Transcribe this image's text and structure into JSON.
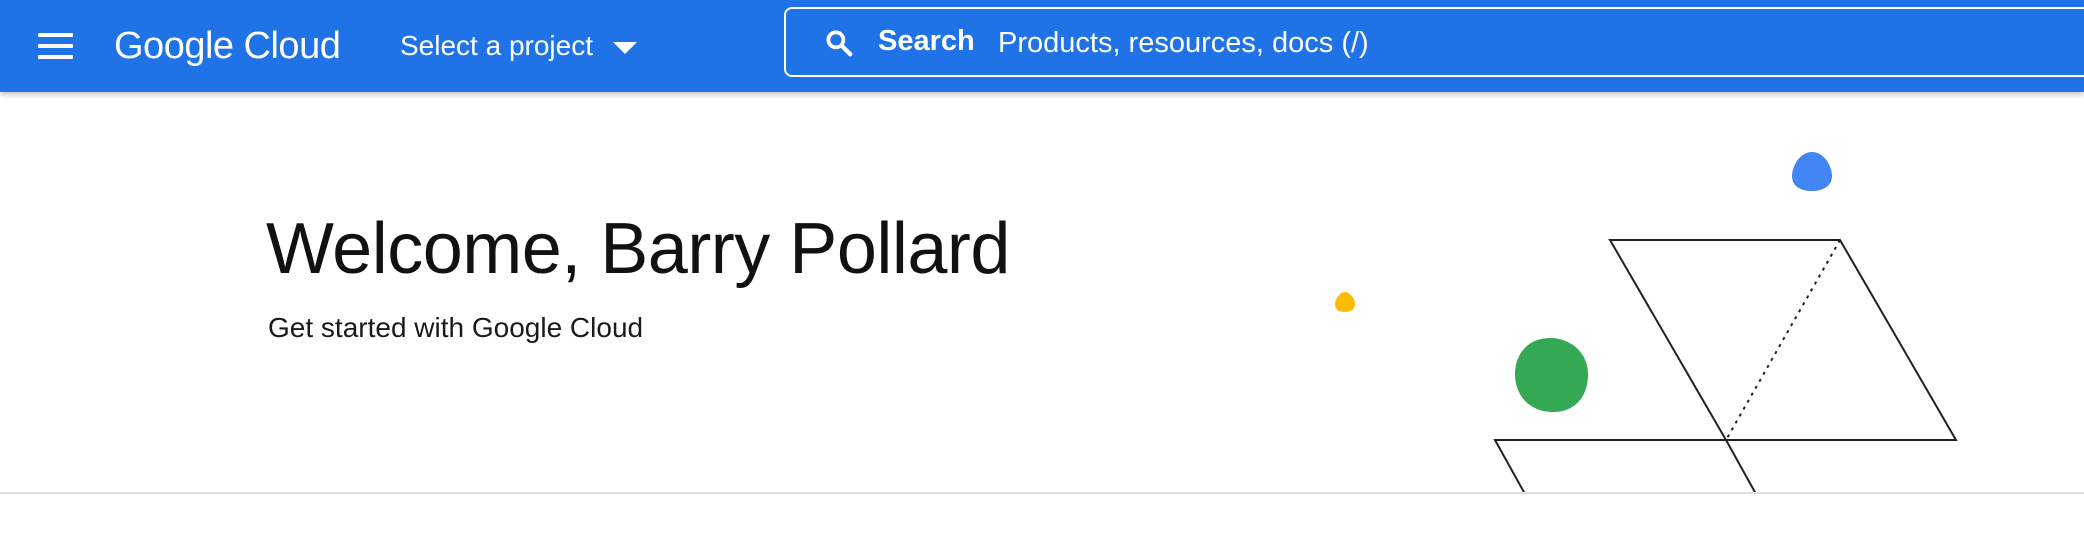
{
  "header": {
    "brand_google": "Google",
    "brand_cloud": "Cloud",
    "project_selector_label": "Select a project",
    "search": {
      "label": "Search",
      "placeholder": "Products, resources, docs (/)"
    }
  },
  "icons": {
    "menu": "hamburger-menu-icon",
    "search": "search-icon",
    "dropdown": "caret-down-icon"
  },
  "main": {
    "title": "Welcome, Barry Pollard",
    "subtitle": "Get started with Google Cloud"
  },
  "colors": {
    "header_bg": "#1f73e6",
    "blue_shape": "#4285f4",
    "green_shape": "#34a853",
    "yellow_shape": "#fbbc04"
  }
}
